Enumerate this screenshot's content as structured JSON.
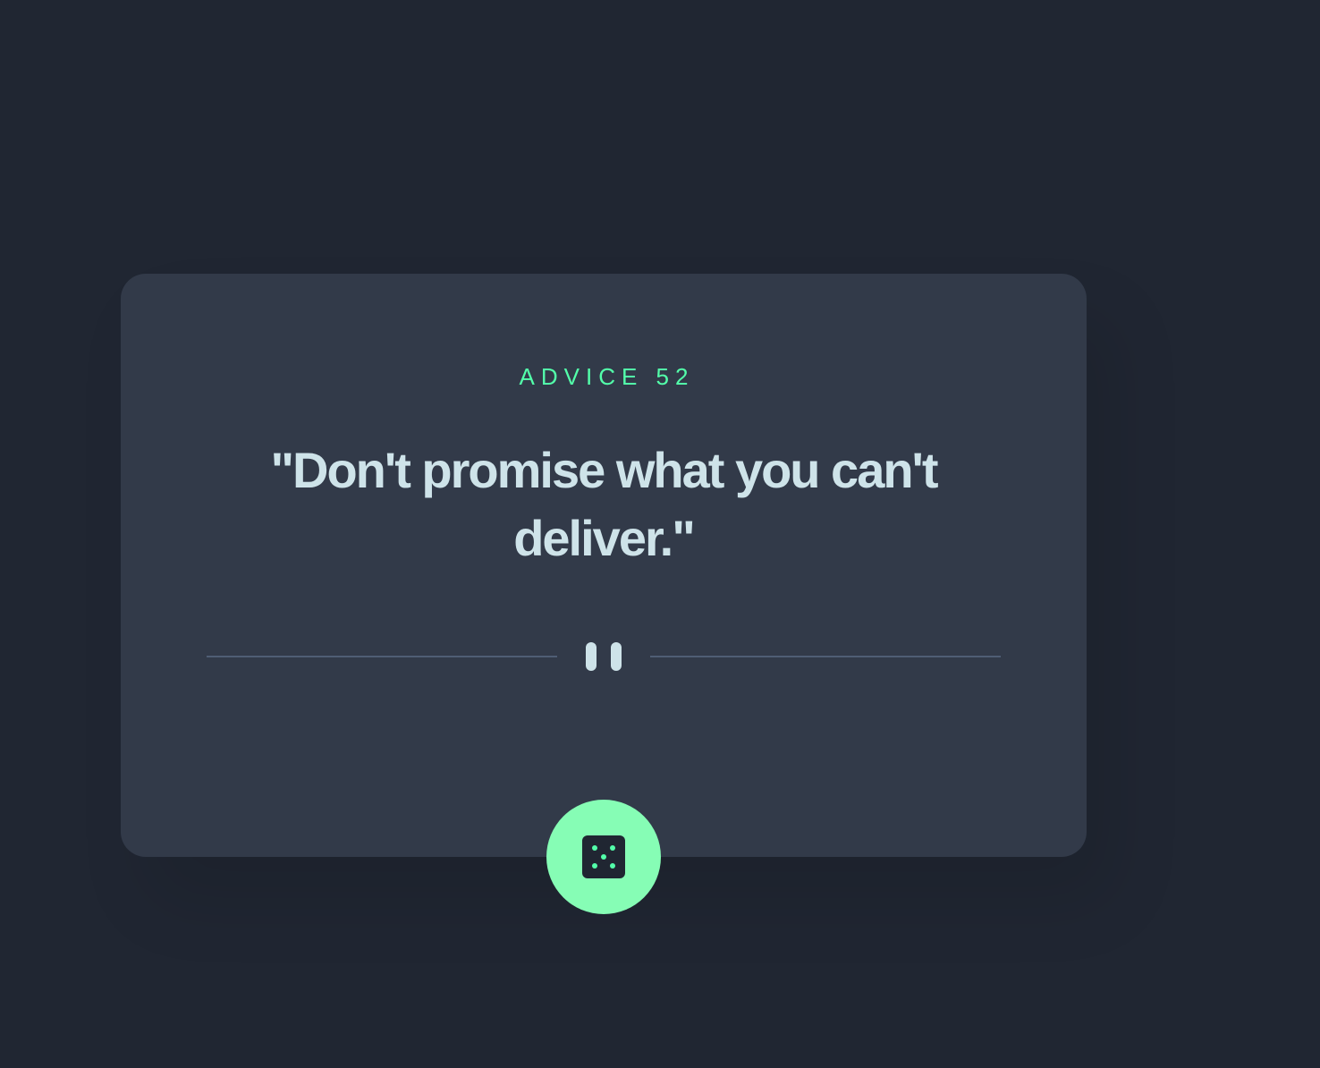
{
  "advice": {
    "id_label": "ADVICE 52",
    "quote": "\"Don't promise what you can't deliver.\""
  },
  "divider": {
    "icon": "pause-icon"
  },
  "dice_button": {
    "icon": "dice-icon"
  },
  "colors": {
    "background": "#202632",
    "card": "#323a49",
    "accent": "#53ffaa",
    "text": "#cee3e9",
    "divider": "#4f5d74"
  }
}
